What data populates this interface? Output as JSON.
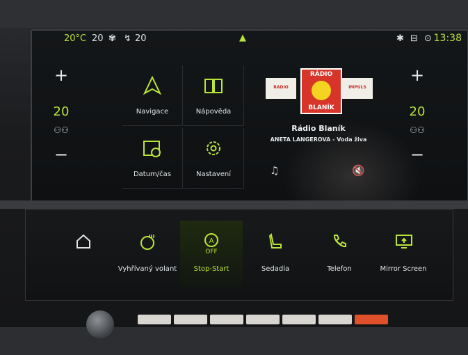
{
  "status": {
    "climate_left": "20°C",
    "climate_temp": "20",
    "fan_icon": "fan-icon",
    "airflow_value": "20",
    "clock": "13:38"
  },
  "left_zone": {
    "plus": "+",
    "temp": "20",
    "minus": "−"
  },
  "right_zone": {
    "plus": "+",
    "temp": "20",
    "minus": "−"
  },
  "tiles": {
    "navigation": "Navigace",
    "help": "Nápověda",
    "datetime": "Datum/čas",
    "settings": "Nastavení"
  },
  "radio": {
    "logo_line1": "RÁDIO",
    "logo_line2": "BLANÍK",
    "left_logo": "RADIO",
    "right_logo": "IMPULS",
    "station": "Rádio Blaník",
    "track": "ANETA LANGEROVA - Voda živa"
  },
  "shortcuts": [
    {
      "label": "",
      "icon": "home-icon"
    },
    {
      "label": "Vyhřívaný volant",
      "icon": "heated-steering-icon"
    },
    {
      "label": "Stop-Start",
      "icon": "stop-start-off-icon",
      "state": "OFF"
    },
    {
      "label": "Sedadla",
      "icon": "seat-icon"
    },
    {
      "label": "Telefon",
      "icon": "phone-icon"
    },
    {
      "label": "Mirror Screen",
      "icon": "mirror-screen-icon"
    }
  ],
  "colors": {
    "accent": "#b9e43a",
    "background": "#0e1012"
  }
}
